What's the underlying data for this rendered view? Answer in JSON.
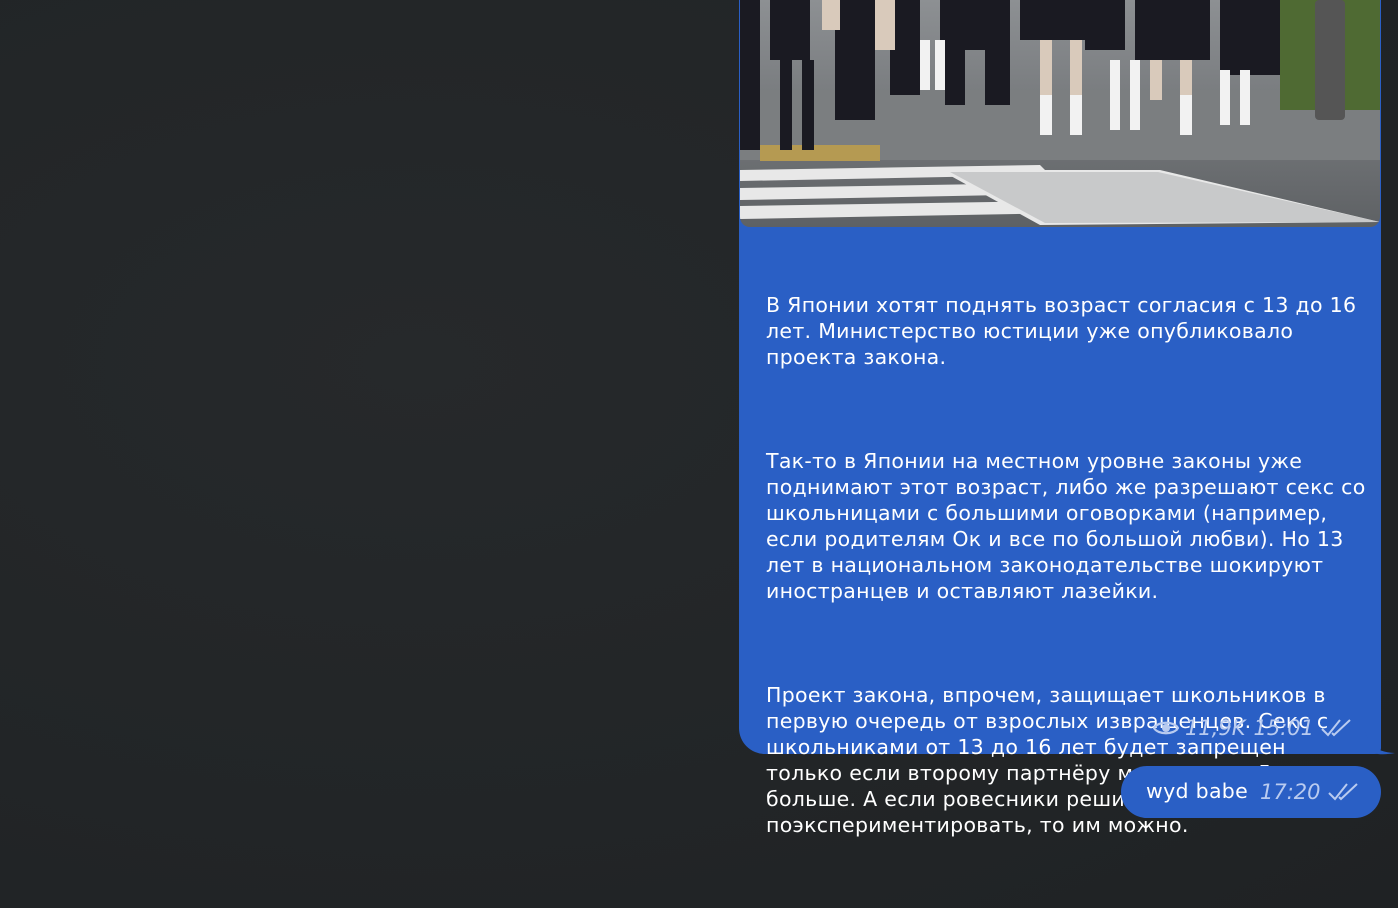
{
  "post": {
    "paragraphs": [
      "В Японии хотят поднять возраст согласия с 13 до 16 лет. Министерство юстиции уже опубликовало проекта закона.",
      "Так-то в Японии на местном уровне законы уже поднимают этот возраст, либо же разрешают секс со школьницами с большими оговорками (например, если родителям Ок и все по большой любви). Но 13 лет в национальном законодательстве шокируют иностранцев и оставляют лазейки.",
      "Проект закона, впрочем, защищает школьников в первую очередь от взрослых извращенцев. Секс с школьниками от 13 до 16 лет будет запрещен только если второму партнёру минимум на 5 лет больше. А если ровесники решили поэкспериментировать, то им можно."
    ],
    "views": "11,9K",
    "time": "15:01",
    "photo_icon": "crowd-photo",
    "views_icon": "eye-icon",
    "status_icon": "double-check-icon"
  },
  "reply": {
    "text": "wyd babe",
    "time": "17:20",
    "status_icon": "double-check-icon"
  },
  "colors": {
    "background": "#232628",
    "bubble": "#2a5fc5",
    "meta_text": "#b9cbf0",
    "text": "#ffffff"
  }
}
